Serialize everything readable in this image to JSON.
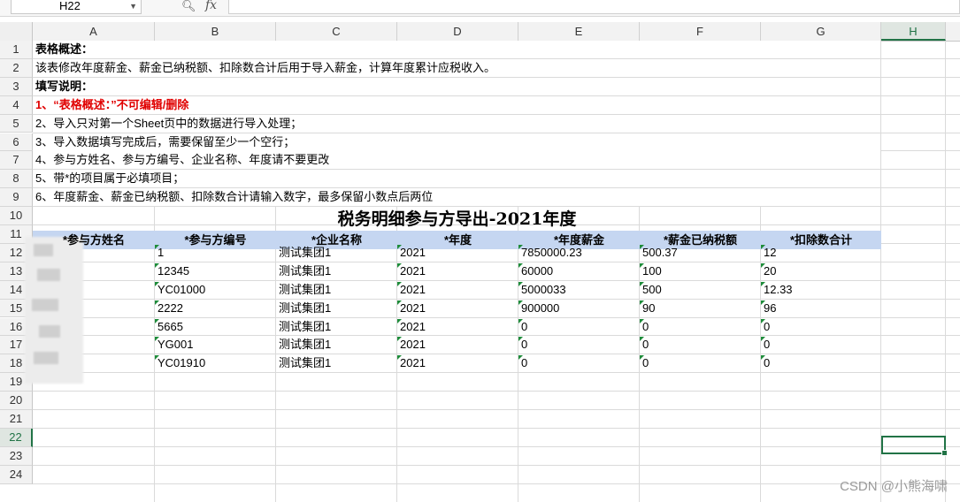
{
  "formula_bar": {
    "name_box": "H22",
    "fx_label": "fx",
    "zoom_icon": "search-icon",
    "formula_value": ""
  },
  "columns": [
    "A",
    "B",
    "C",
    "D",
    "E",
    "F",
    "G",
    "H"
  ],
  "selected_column": "H",
  "rows": [
    "1",
    "2",
    "3",
    "4",
    "5",
    "6",
    "7",
    "8",
    "9",
    "10",
    "11",
    "12",
    "13",
    "14",
    "15",
    "16",
    "17",
    "18",
    "19",
    "20",
    "21",
    "22",
    "23",
    "24"
  ],
  "selected_row": "22",
  "instructions": {
    "overview_label": "表格概述：",
    "overview_text": "该表修改年度薪金、薪金已纳税额、扣除数合计后用于导入薪金，计算年度累计应税收入。",
    "guide_label": "填写说明：",
    "items": [
      "1、“表格概述：”不可编辑/删除",
      "2、导入只对第一个Sheet页中的数据进行导入处理；",
      "3、导入数据填写完成后，需要保留至少一个空行；",
      "4、参与方姓名、参与方编号、企业名称、年度请不要更改",
      "5、带*的项目属于必填项目；",
      "6、年度薪金、薪金已纳税额、扣除数合计请输入数字，最多保留小数点后两位"
    ]
  },
  "table": {
    "title": "税务明细参与方导出-2021年度",
    "headers": [
      "*参与方姓名",
      "*参与方编号",
      "*企业名称",
      "*年度",
      "*年度薪金",
      "*薪金已纳税额",
      "*扣除数合计"
    ],
    "rows": [
      [
        "",
        "1",
        "测试集团1",
        "2021",
        "7850000.23",
        "500.37",
        "12"
      ],
      [
        "",
        "12345",
        "测试集团1",
        "2021",
        "60000",
        "100",
        "20"
      ],
      [
        "",
        "YC01000",
        "测试集团1",
        "2021",
        "5000033",
        "500",
        "12.33"
      ],
      [
        "",
        "2222",
        "测试集团1",
        "2021",
        "900000",
        "90",
        "96"
      ],
      [
        "",
        "5665",
        "测试集团1",
        "2021",
        "0",
        "0",
        "0"
      ],
      [
        "",
        "YG001",
        "测试集团1",
        "2021",
        "0",
        "0",
        "0"
      ],
      [
        "",
        "YC01910",
        "测试集团1",
        "2021",
        "0",
        "0",
        "0"
      ]
    ]
  },
  "visible_row_labels_partial": {
    "12": "1",
    "13": "13",
    "14": "14",
    "15": "1",
    "16": "1",
    "17": "1"
  },
  "watermark": "CSDN @小熊海啸",
  "colors": {
    "selection": "#217346",
    "header_band": "#c5d6f1",
    "warning_text": "#e00000"
  }
}
